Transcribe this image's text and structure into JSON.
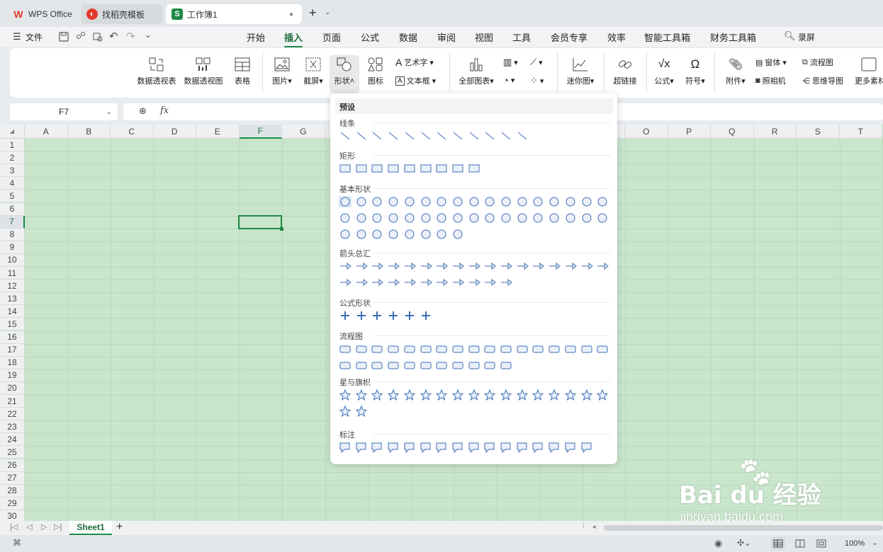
{
  "tabs": [
    {
      "label": "WPS Office",
      "icon": "wps-logo-icon"
    },
    {
      "label": "找稻壳模板",
      "icon": "docer-icon"
    },
    {
      "label": "工作簿1",
      "icon": "sheet-s-icon",
      "active": true
    }
  ],
  "menu": {
    "file": "文件",
    "tabs": [
      "开始",
      "插入",
      "页面",
      "公式",
      "数据",
      "审阅",
      "视图",
      "工具",
      "会员专享",
      "效率",
      "智能工具箱",
      "财务工具箱"
    ],
    "active": "插入",
    "search": "录屏"
  },
  "ribbon": {
    "pivot_table": "数据透视表",
    "pivot_chart": "数据透视图",
    "table": "表格",
    "picture": "图片",
    "screenshot": "截屏",
    "shape": "形状",
    "icon": "图标",
    "art_text": "艺术字",
    "text_box": "文本框",
    "all_charts": "全部图表",
    "sparkline": "迷你图",
    "hyperlink": "超链接",
    "formula": "公式",
    "symbol": "符号",
    "attachment": "附件",
    "window": "窗体",
    "camera": "照相机",
    "flowchart": "流程图",
    "mindmap": "思维导图",
    "more": "更多素材"
  },
  "formula_bar": {
    "cell": "F7",
    "fx": "fx"
  },
  "columns": [
    "A",
    "B",
    "C",
    "D",
    "E",
    "F",
    "G",
    "H",
    "I",
    "J",
    "K",
    "L",
    "M",
    "N",
    "O",
    "P",
    "Q",
    "R",
    "S",
    "T"
  ],
  "rows": [
    "1",
    "2",
    "3",
    "4",
    "5",
    "6",
    "7",
    "8",
    "9",
    "10",
    "11",
    "12",
    "13",
    "14",
    "15",
    "16",
    "17",
    "18",
    "19",
    "20",
    "21",
    "22",
    "23",
    "24",
    "25",
    "26",
    "27",
    "28",
    "29",
    "30"
  ],
  "shape_menu": {
    "header": "预设",
    "sections": [
      {
        "title": "线条",
        "count": 12
      },
      {
        "title": "矩形",
        "count": 9
      },
      {
        "title": "基本形状",
        "count": 42
      },
      {
        "title": "箭头总汇",
        "count": 28
      },
      {
        "title": "公式形状",
        "count": 6
      },
      {
        "title": "流程图",
        "count": 28
      },
      {
        "title": "星与旗帜",
        "count": 19
      },
      {
        "title": "标注",
        "count": 16
      }
    ]
  },
  "sheet_tab": "Sheet1",
  "status": {
    "zoom": "100%"
  },
  "watermark": {
    "brand": "Bai du 经验",
    "url": "jingyan.baidu.com"
  },
  "colors": {
    "accent": "#1d8a46",
    "shape_stroke": "#3b6fb6",
    "grid_bg": "#c9e6cc"
  }
}
